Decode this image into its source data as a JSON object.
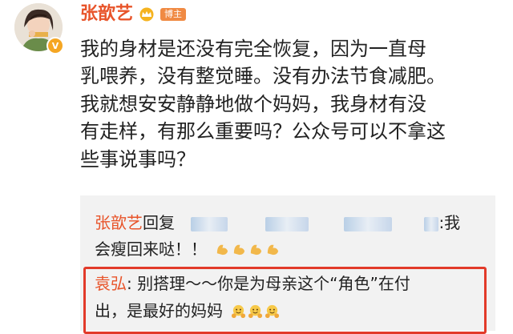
{
  "profile": {
    "username": "张歆艺",
    "badge": "博主",
    "verified_symbol": "V",
    "avatar_icon": "avatar-photo",
    "crown_icon": "crown-icon",
    "name_color": "#e8542a"
  },
  "post": {
    "lines": [
      "我的身材是还没有完全恢复，因为一直母",
      "乳喂养，没有整觉睡。没有办法节食减肥。",
      "我就想安安静静地做个妈妈，我身材有没",
      "有走样，有那么重要吗？公众号可以不拿这",
      "些事说事吗？"
    ]
  },
  "replies": [
    {
      "author": "张歆艺",
      "action": "回复",
      "redacted": true,
      "line1_tail": ":我",
      "line2": "会瘦回来哒！！",
      "emoji": "flexed-biceps-icon"
    },
    {
      "author": "袁弘",
      "text_line1": ": 别搭理～～你是为母亲这个“角色”在付",
      "text_line2": "出，是最好的妈妈",
      "emoji": "hugging-face-icon",
      "highlighted": true,
      "highlight_color": "#e23a2a"
    }
  ]
}
